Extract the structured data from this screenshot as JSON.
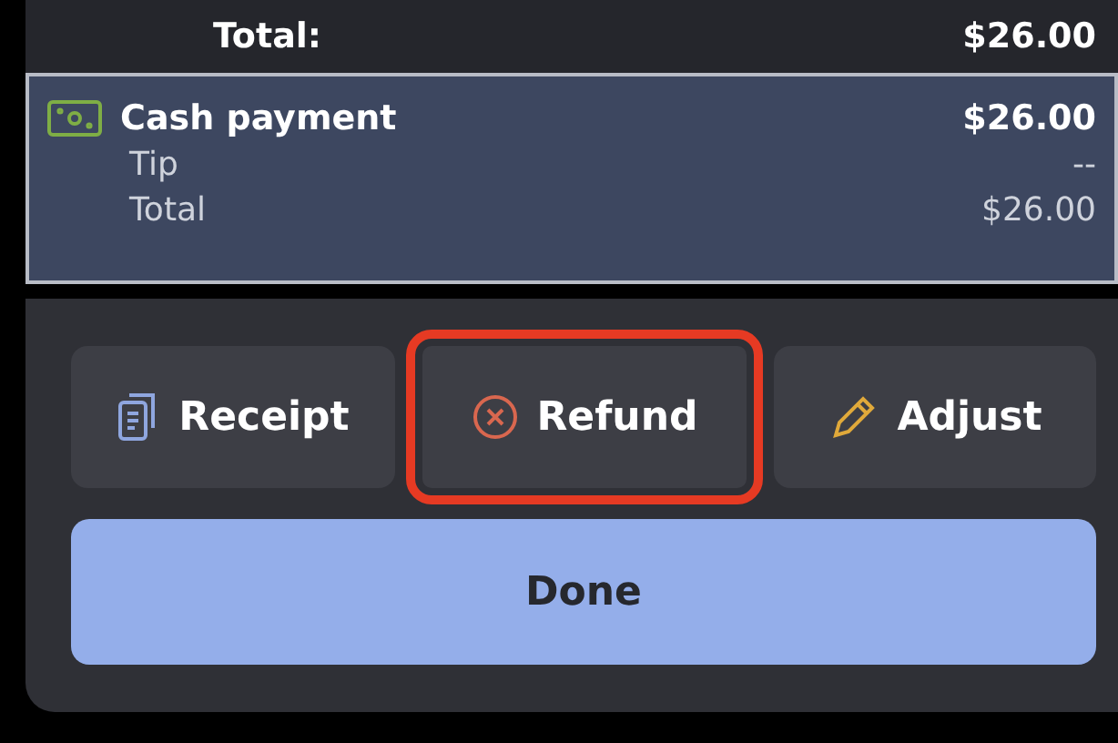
{
  "summary": {
    "label": "Total:",
    "amount": "$26.00"
  },
  "payment": {
    "method": "Cash payment",
    "amount": "$26.00",
    "lines": [
      {
        "label": "Tip",
        "value": "--"
      },
      {
        "label": "Total",
        "value": "$26.00"
      }
    ]
  },
  "actions": [
    {
      "kind": "receipt",
      "label": "Receipt",
      "highlighted": false
    },
    {
      "kind": "refund",
      "label": "Refund",
      "highlighted": true
    },
    {
      "kind": "adjust",
      "label": "Adjust",
      "highlighted": false
    }
  ],
  "primary_button": "Done"
}
